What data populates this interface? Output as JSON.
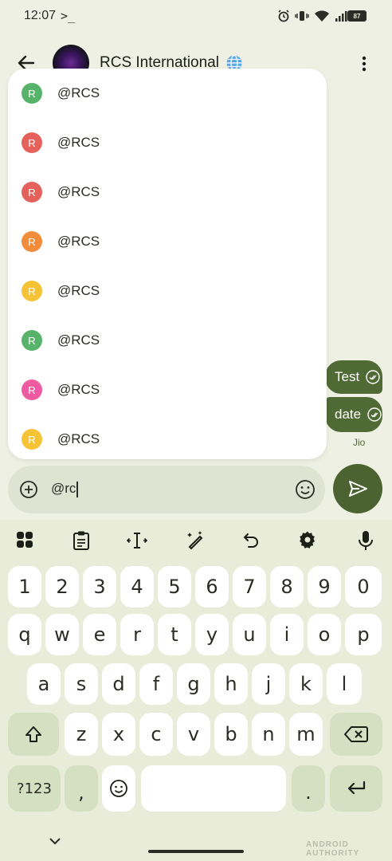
{
  "status_bar": {
    "time": "12:07",
    "prompt": ">_",
    "battery": "87"
  },
  "header": {
    "contact_name": "RCS International"
  },
  "messages": [
    {
      "text": "Test"
    },
    {
      "text": "date"
    }
  ],
  "carrier": "Jio",
  "suggestions": [
    {
      "initial": "R",
      "label": "@RCS",
      "color": "#57b36a"
    },
    {
      "initial": "R",
      "label": "@RCS",
      "color": "#e5625c"
    },
    {
      "initial": "R",
      "label": "@RCS",
      "color": "#e5625c"
    },
    {
      "initial": "R",
      "label": "@RCS",
      "color": "#f28c3b"
    },
    {
      "initial": "R",
      "label": "@RCS",
      "color": "#f6c337"
    },
    {
      "initial": "R",
      "label": "@RCS",
      "color": "#57b36a"
    },
    {
      "initial": "R",
      "label": "@RCS",
      "color": "#f05aa0"
    },
    {
      "initial": "R",
      "label": "@RCS",
      "color": "#f6c337"
    }
  ],
  "compose": {
    "value": "@rc"
  },
  "keyboard": {
    "row_numbers": [
      "1",
      "2",
      "3",
      "4",
      "5",
      "6",
      "7",
      "8",
      "9",
      "0"
    ],
    "row1": [
      "q",
      "w",
      "e",
      "r",
      "t",
      "y",
      "u",
      "i",
      "o",
      "p"
    ],
    "row2": [
      "a",
      "s",
      "d",
      "f",
      "g",
      "h",
      "j",
      "k",
      "l"
    ],
    "row3": [
      "z",
      "x",
      "c",
      "v",
      "b",
      "n",
      "m"
    ],
    "symbols_label": "?123",
    "comma": ",",
    "period": "."
  },
  "watermark": "ANDROID AUTHORITY",
  "colors": {
    "accent": "#4a6330",
    "bubble": "#4f6a35",
    "background": "#eef0e4"
  }
}
